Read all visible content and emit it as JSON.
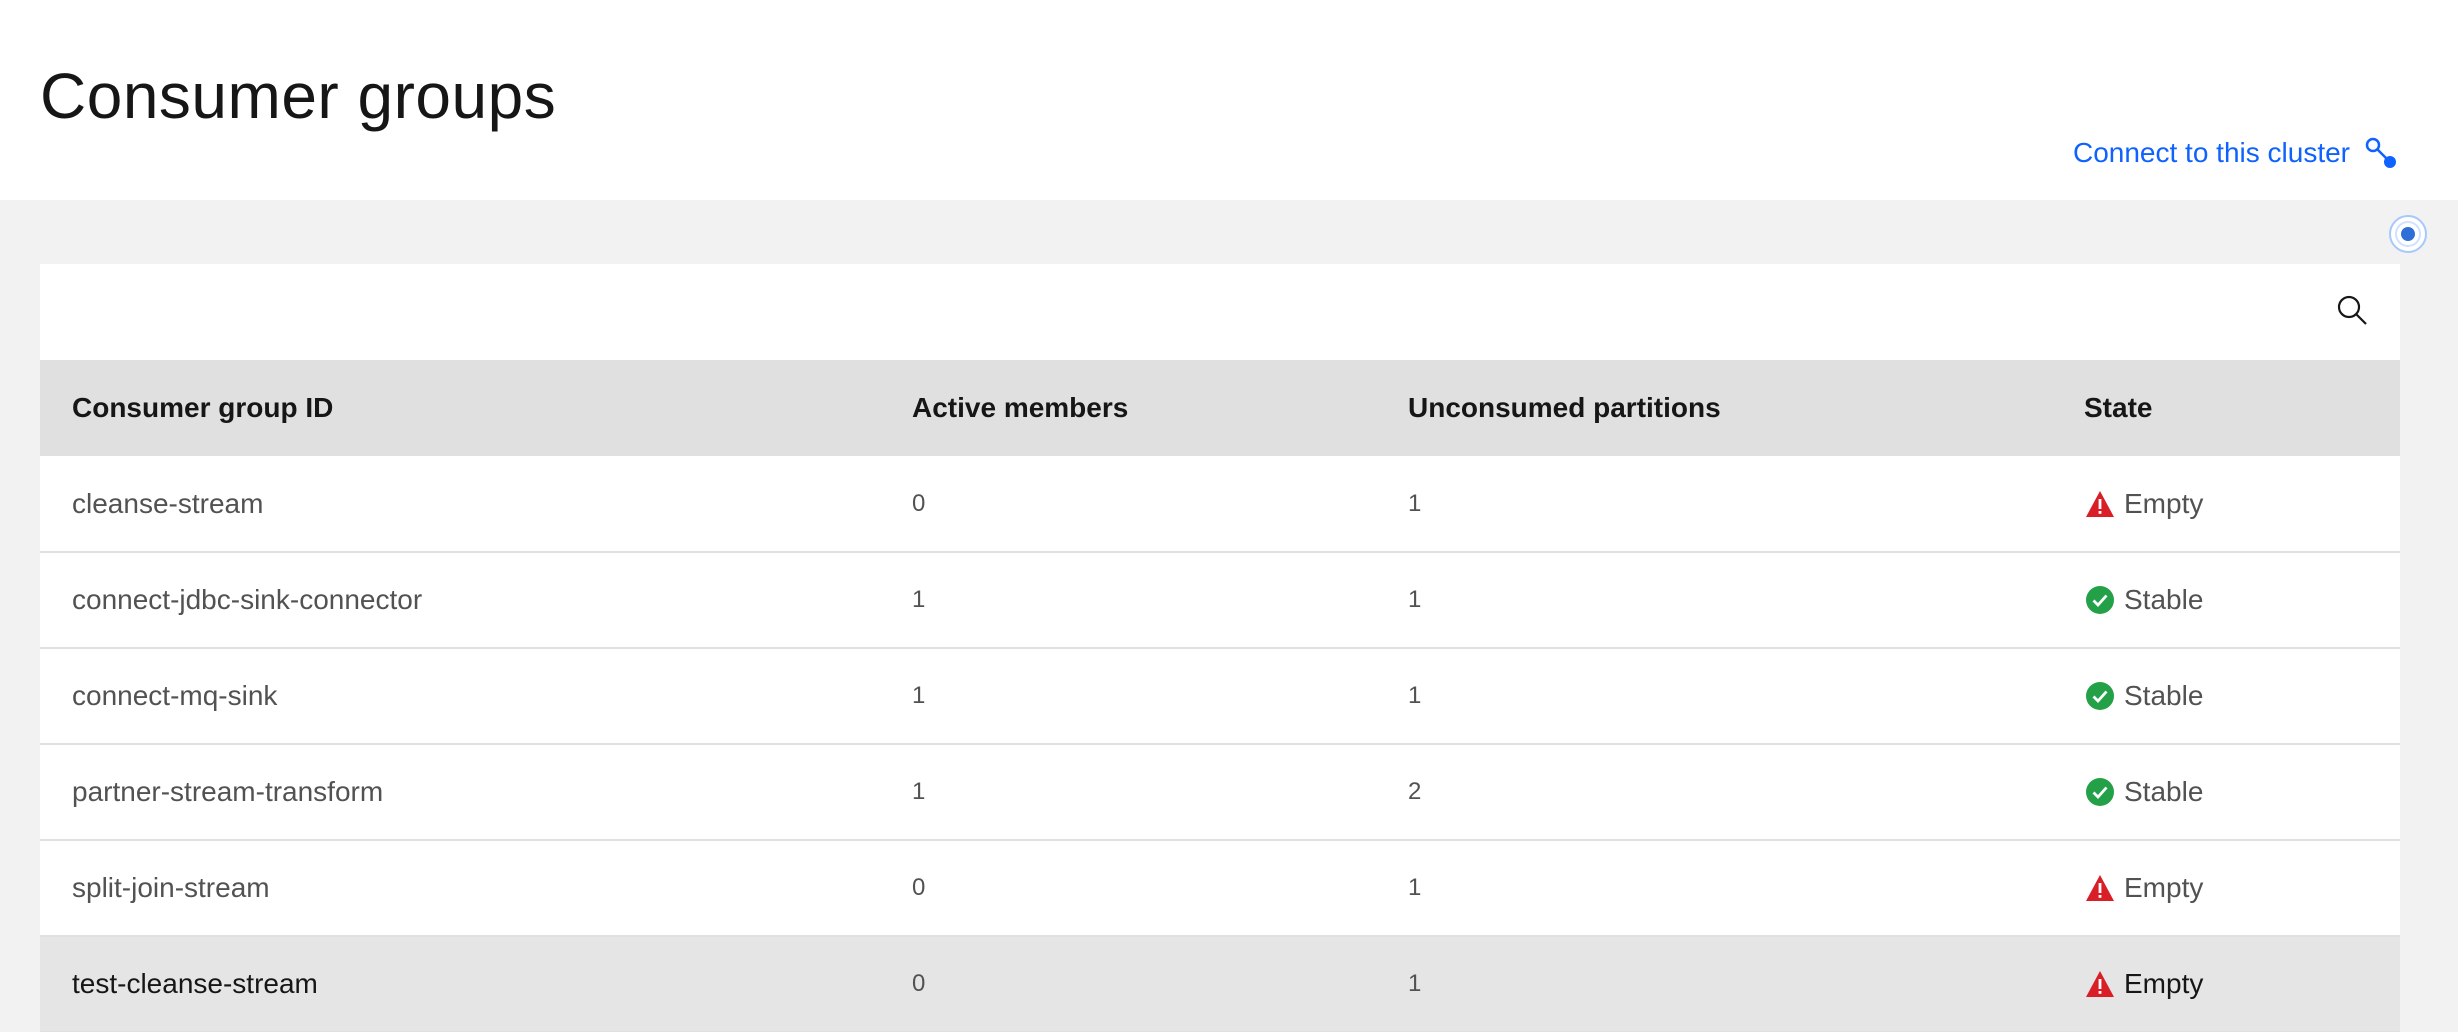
{
  "header": {
    "title": "Consumer groups",
    "connect_label": "Connect to this cluster"
  },
  "table": {
    "columns": [
      "Consumer group ID",
      "Active members",
      "Unconsumed partitions",
      "State"
    ],
    "rows": [
      {
        "id": "cleanse-stream",
        "active": "0",
        "unconsumed": "1",
        "state": "Empty",
        "state_icon": "warning-icon"
      },
      {
        "id": "connect-jdbc-sink-connector",
        "active": "1",
        "unconsumed": "1",
        "state": "Stable",
        "state_icon": "checkmark-icon"
      },
      {
        "id": "connect-mq-sink",
        "active": "1",
        "unconsumed": "1",
        "state": "Stable",
        "state_icon": "checkmark-icon"
      },
      {
        "id": "partner-stream-transform",
        "active": "1",
        "unconsumed": "2",
        "state": "Stable",
        "state_icon": "checkmark-icon"
      },
      {
        "id": "split-join-stream",
        "active": "0",
        "unconsumed": "1",
        "state": "Empty",
        "state_icon": "warning-icon"
      },
      {
        "id": "test-cleanse-stream",
        "active": "0",
        "unconsumed": "1",
        "state": "Empty",
        "state_icon": "warning-icon"
      }
    ]
  },
  "colors": {
    "link": "#0f62fe",
    "warning": "#da1e28",
    "success": "#24a148"
  }
}
